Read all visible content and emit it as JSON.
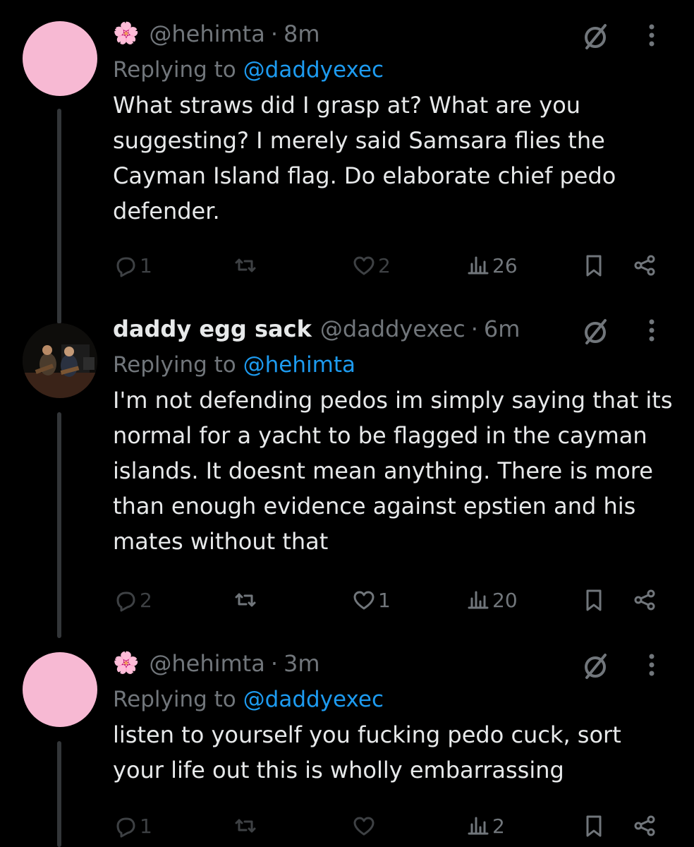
{
  "tweets": [
    {
      "display_name": "",
      "avatar": "pink-avatar",
      "emoji": "🌸",
      "handle": "@hehimta",
      "time": "8m",
      "replying_label": "Replying to",
      "replying_to": "@daddyexec",
      "text": "What straws did I grasp at? What are you suggesting? I merely said Samsara flies the Cayman Island flag. Do elaborate chief pedo defender.",
      "replies": "1",
      "retweets": "",
      "likes": "2",
      "views": "26"
    },
    {
      "display_name": "daddy egg sack",
      "avatar": "photo-avatar",
      "emoji": "",
      "handle": "@daddyexec",
      "time": "6m",
      "replying_label": "Replying to",
      "replying_to": "@hehimta",
      "text": "I'm not defending pedos im simply saying that its normal for a yacht to be flagged in the cayman islands. It doesnt mean anything. There is more than enough evidence against epstien and his mates without that",
      "replies": "2",
      "retweets": "",
      "likes": "1",
      "views": "20"
    },
    {
      "display_name": "",
      "avatar": "pink-avatar",
      "emoji": "🌸",
      "handle": "@hehimta",
      "time": "3m",
      "replying_label": "Replying to",
      "replying_to": "@daddyexec",
      "text": "listen to yourself you fucking pedo cuck, sort your life out this is wholly embarrassing",
      "replies": "1",
      "retweets": "",
      "likes": "",
      "views": "2"
    }
  ],
  "colors": {
    "background": "#000000",
    "text": "#e7e9ea",
    "muted": "#71767b",
    "link": "#1d9bf0",
    "avatar_pink": "#f7b9d3"
  }
}
